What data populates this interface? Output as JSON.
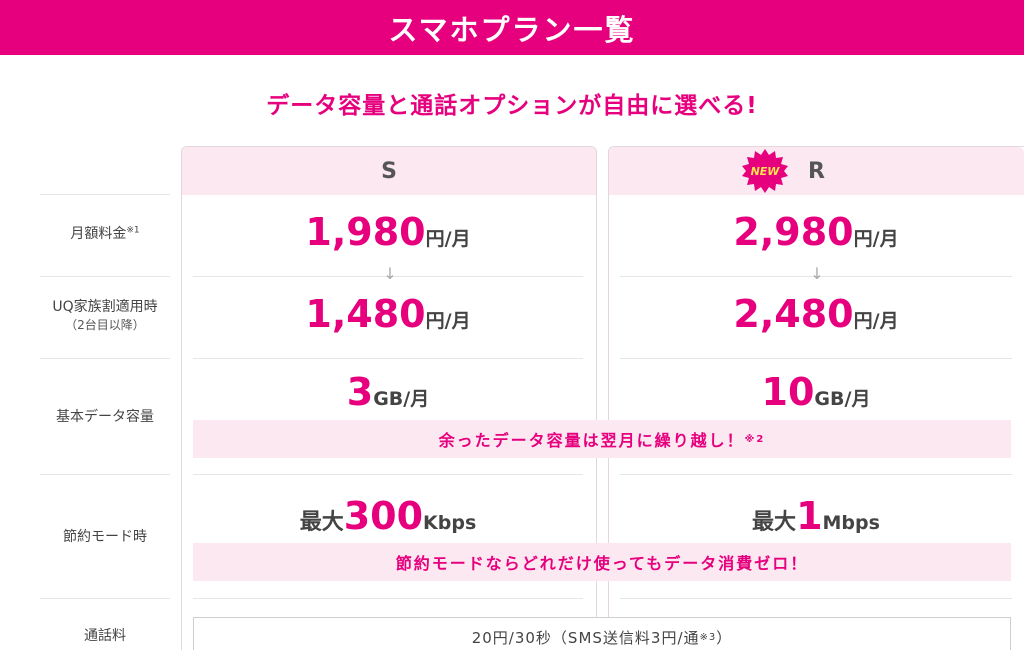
{
  "header": {
    "title": "スマホプラン一覧"
  },
  "subtitle": "データ容量と通話オプションが自由に選べる!",
  "plans": [
    {
      "name": "S",
      "price": "1,980",
      "price_unit": "円/月",
      "family_price": "1,480",
      "family_unit": "円/月",
      "data_amount": "3",
      "data_unit": "GB/月",
      "saving_prefix": "最大",
      "saving_value": "300",
      "saving_unit": "Kbps"
    },
    {
      "name": "R",
      "badge": "NEW",
      "price": "2,980",
      "price_unit": "円/月",
      "family_price": "2,480",
      "family_unit": "円/月",
      "data_amount": "10",
      "data_unit": "GB/月",
      "saving_prefix": "最大",
      "saving_value": "1",
      "saving_unit": "Mbps"
    }
  ],
  "rows": {
    "monthly_fee": {
      "label": "月額料金",
      "note": "※1"
    },
    "family_discount": {
      "label": "UQ家族割適用時",
      "sublabel": "（2台目以降）"
    },
    "basic_data": {
      "label": "基本データ容量"
    },
    "saving_mode": {
      "label": "節約モード時"
    },
    "call_fee": {
      "label": "通話料"
    }
  },
  "arrow_symbol": "↓",
  "carryover": {
    "text": "余ったデータ容量は翌月に繰り越し！",
    "note": "※2"
  },
  "saving_banner": "節約モードならどれだけ使ってもデータ消費ゼロ！",
  "call_fee": {
    "text": "20円/30秒（SMS送信料3円/通",
    "note": "※3",
    "close": "）"
  },
  "colors": {
    "brand": "#e6007e",
    "band": "#fce8f1",
    "header_bg": "#fbe8f0",
    "badge_bg": "#e6007e",
    "badge_text": "#ffe34d"
  }
}
